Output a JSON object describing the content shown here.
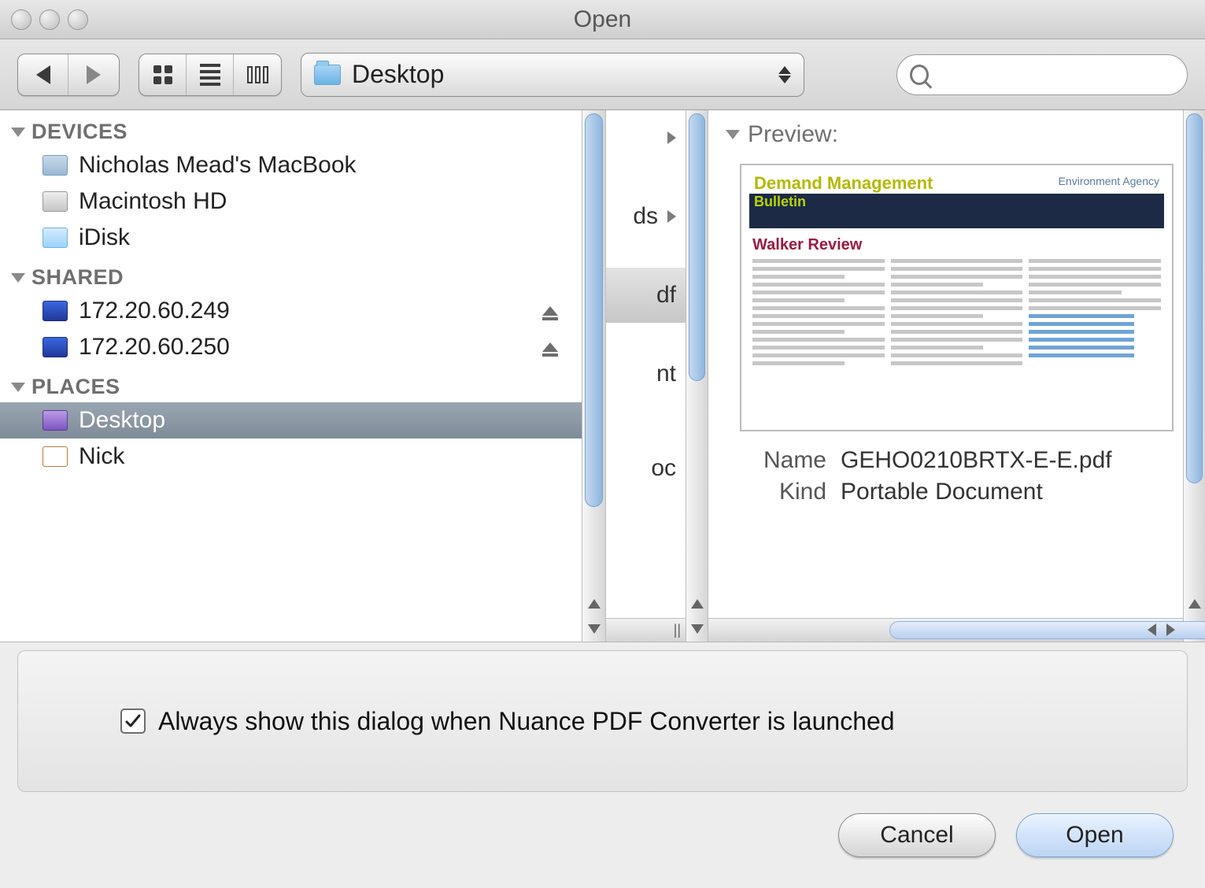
{
  "window": {
    "title": "Open"
  },
  "toolbar": {
    "location_label": "Desktop",
    "search_placeholder": ""
  },
  "sidebar": {
    "sections": [
      {
        "title": "DEVICES",
        "items": [
          {
            "label": "Nicholas Mead's MacBook",
            "icon": "laptop"
          },
          {
            "label": "Macintosh HD",
            "icon": "hdd"
          },
          {
            "label": "iDisk",
            "icon": "idisk"
          }
        ]
      },
      {
        "title": "SHARED",
        "items": [
          {
            "label": "172.20.60.249",
            "icon": "net",
            "eject": true
          },
          {
            "label": "172.20.60.250",
            "icon": "net",
            "eject": true
          }
        ]
      },
      {
        "title": "PLACES",
        "items": [
          {
            "label": "Desktop",
            "icon": "desktop",
            "selected": true
          },
          {
            "label": "Nick",
            "icon": "home"
          }
        ]
      }
    ]
  },
  "filecolumn": {
    "items": [
      {
        "frag": "",
        "chevron": true
      },
      {
        "frag": "ds",
        "chevron": true
      },
      {
        "frag": "df",
        "selected": true
      },
      {
        "frag": ""
      },
      {
        "frag": "nt"
      },
      {
        "frag": ""
      },
      {
        "frag": "oc"
      }
    ]
  },
  "preview": {
    "header": "Preview:",
    "doc_title": "Demand Management",
    "doc_subtitle": "Bulletin",
    "doc_logo": "Environment Agency",
    "doc_section": "Walker Review",
    "meta": {
      "name_key": "Name",
      "name_val": "GEHO0210BRTX-E-E.pdf",
      "kind_key": "Kind",
      "kind_val": "Portable Document"
    }
  },
  "options": {
    "checkbox_checked": true,
    "label": "Always show this dialog when Nuance PDF Converter is launched"
  },
  "footer": {
    "cancel": "Cancel",
    "open": "Open"
  }
}
